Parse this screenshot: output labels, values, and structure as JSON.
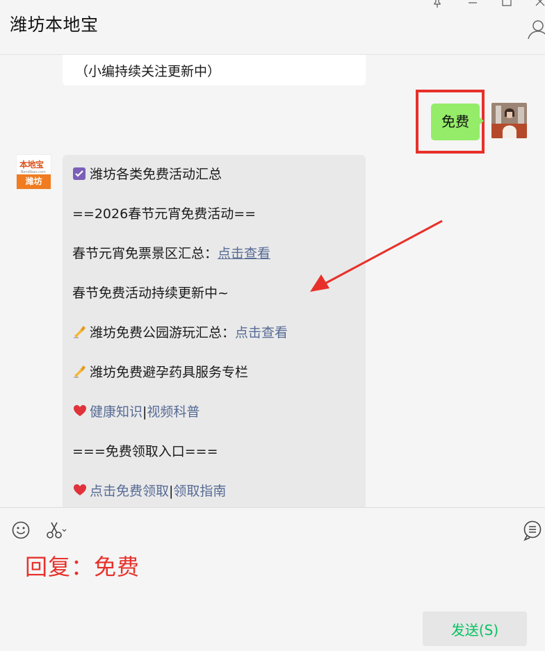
{
  "window": {
    "title": "潍坊本地宝",
    "controls": [
      "pin-icon",
      "minimize-icon",
      "maximize-icon",
      "close-icon"
    ]
  },
  "chat": {
    "previous_message": "（小编持续关注更新中）",
    "sent_message": "免费",
    "bot_avatar": {
      "logo": "本地宝",
      "logo_sub": "Bendibao.com",
      "city": "潍坊"
    },
    "bot_message": {
      "title": "潍坊各类免费活动汇总",
      "line2": "==2026春节元宵免费活动==",
      "line3_text": "春节元宵免票景区汇总：",
      "line3_link": "点击查看",
      "line4": "春节免费活动持续更新中~",
      "line5_text": "潍坊免费公园游玩汇总：",
      "line5_link": "点击查看",
      "line6": "潍坊免费避孕药具服务专栏",
      "line7_link1": "健康知识",
      "line7_sep": "|",
      "line7_link2": "视频科普",
      "line8": "===免费领取入口===",
      "line9_link1": "点击免费领取",
      "line9_sep": "|",
      "line9_link2": "领取指南"
    }
  },
  "input": {
    "emoji_icon": "smile-icon",
    "scissors_icon": "scissors-icon",
    "chat_history_icon": "chat-history-icon",
    "reply_text": "回复：免费",
    "send_label": "发送(S)"
  },
  "colors": {
    "annotation_red": "#e8302a",
    "sent_bubble": "#95ec69",
    "link": "#576b95",
    "send_text": "#07c160"
  }
}
